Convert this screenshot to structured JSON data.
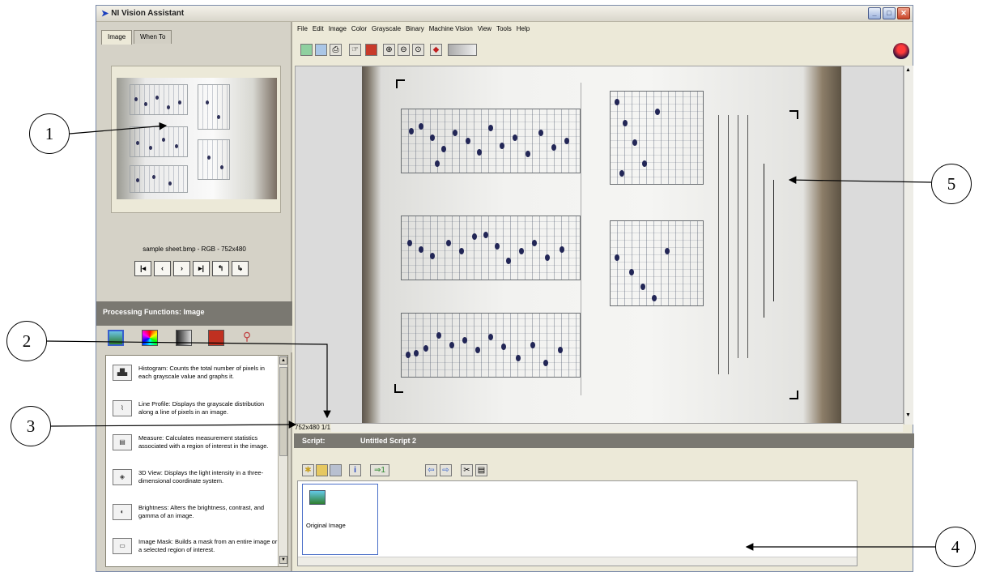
{
  "window": {
    "title": "NI Vision Assistant"
  },
  "left_panel": {
    "tabs": [
      {
        "label": "Image"
      },
      {
        "label": "When To"
      }
    ],
    "file_info": "sample sheet.bmp - RGB - 752x480",
    "processing_header": "Processing Functions: Image",
    "functions": [
      {
        "icon": "histogram-icon",
        "text": "Histogram:  Counts the total number of pixels in each grayscale value and graphs it."
      },
      {
        "icon": "line-profile-icon",
        "text": "Line Profile:  Displays the grayscale distribution along a line of pixels in an image."
      },
      {
        "icon": "measure-icon",
        "text": "Measure:  Calculates measurement statistics associated with a region of interest in the image."
      },
      {
        "icon": "3d-view-icon",
        "text": "3D View:  Displays the light intensity in a three-dimensional coordinate system."
      },
      {
        "icon": "brightness-icon",
        "text": "Brightness:  Alters the brightness, contrast, and gamma of an image."
      },
      {
        "icon": "image-mask-icon",
        "text": "Image Mask:  Builds a mask from an entire image or a selected region of interest."
      }
    ]
  },
  "menubar": {
    "items": [
      "File",
      "Edit",
      "Image",
      "Color",
      "Grayscale",
      "Binary",
      "Machine Vision",
      "View",
      "Tools",
      "Help"
    ]
  },
  "viewer": {
    "zoom_label": "752x480 1/1"
  },
  "script": {
    "label": "Script:",
    "name": "Untitled Script 2",
    "step_label": "Original Image"
  },
  "callouts": [
    "1",
    "2",
    "3",
    "4",
    "5"
  ]
}
